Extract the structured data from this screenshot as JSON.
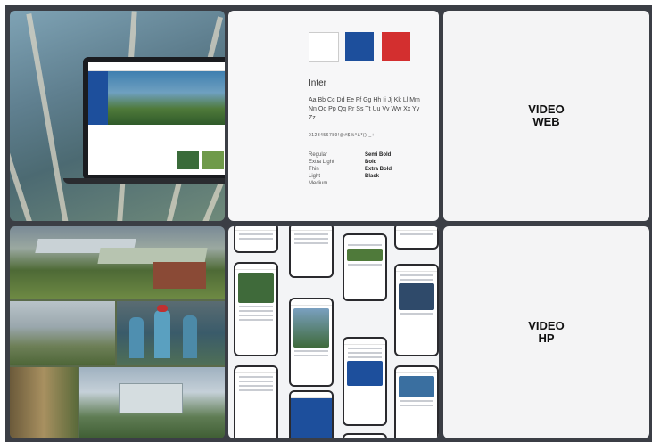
{
  "brand": {
    "swatches": [
      "#ffffff",
      "#1d4f9c",
      "#d32f2f"
    ],
    "font_name": "Inter",
    "alphabet": "Aa Bb Cc Dd Ee Ff Gg Hh Ii Jj Kk Ll Mm Nn Oo Pp Qq Rr Ss Tt Uu Vv Ww Xx Yy Zz",
    "digits": "0123456789!@#$%^&*()-_+",
    "weights_left": [
      "Regular",
      "Extra Light",
      "Thin",
      "Light",
      "Medium"
    ],
    "weights_right": [
      "Semi Bold",
      "Bold",
      "Extra Bold",
      "Black"
    ]
  },
  "tiles": {
    "video_web_line1": "VIDEO",
    "video_web_line2": "WEB",
    "video_hp_line1": "VIDEO",
    "video_hp_line2": "HP"
  },
  "icons": {
    "laptop": "laptop-mockup-icon",
    "phone": "phone-mockup-icon"
  }
}
